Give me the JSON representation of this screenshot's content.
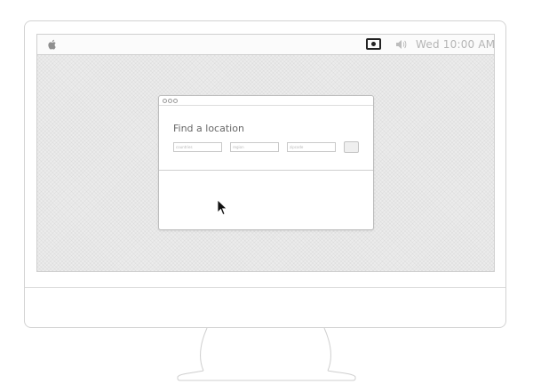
{
  "menubar": {
    "clock": "Wed 10:00 AM",
    "icons": [
      "apple-icon",
      "record-icon",
      "volume-icon"
    ]
  },
  "window": {
    "heading": "Find a location",
    "fields": [
      {
        "placeholder": "countries"
      },
      {
        "placeholder": "region"
      },
      {
        "placeholder": "zipcode"
      }
    ]
  },
  "colors": {
    "screen_bg": "#ececec",
    "outline": "#d3d3d3",
    "clock_text": "#b5b5b5",
    "heading_text": "#666666"
  }
}
